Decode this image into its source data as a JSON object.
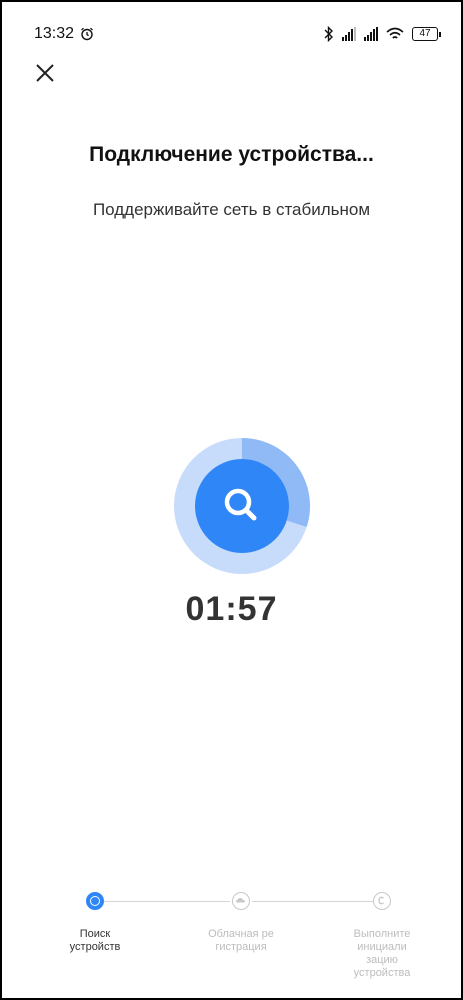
{
  "status_bar": {
    "time": "13:32",
    "battery": "47"
  },
  "header": {
    "title": "Подключение устройства...",
    "subtitle": "Поддерживайте сеть в стабильном"
  },
  "progress": {
    "timer": "01:57",
    "ring_fill_fraction": 0.3
  },
  "steps": [
    {
      "label": "Поиск устройств",
      "state": "active"
    },
    {
      "label": "Облачная регистрация",
      "state": "pending"
    },
    {
      "label": "Выполните инициализацию устройства",
      "state": "pending"
    }
  ],
  "step_label_lines": [
    [
      "Поиск",
      "устройств"
    ],
    [
      "Облачная ре",
      "гистрация"
    ],
    [
      "Выполните",
      "инициали",
      "зацию",
      "устройства"
    ]
  ],
  "colors": {
    "accent": "#2f86f6",
    "ring_light": "#c7dcfb",
    "ring_mid": "#8fbaf5",
    "inactive": "#c8c8c8"
  }
}
